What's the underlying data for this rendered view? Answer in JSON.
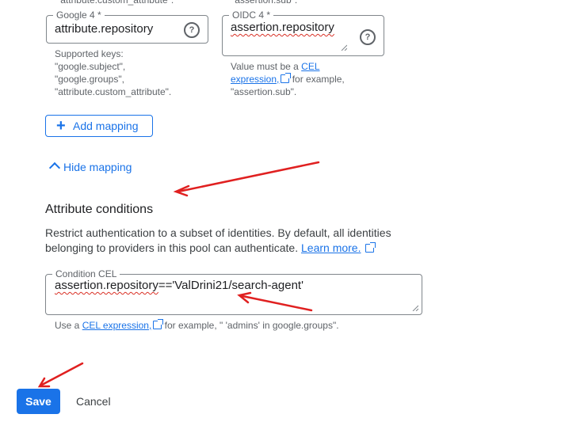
{
  "top_cut": {
    "left_hint_tail": "\"attribute.custom_attribute\".",
    "right_hint_tail": "\"assertion.sub\"."
  },
  "google_field": {
    "label": "Google 4 *",
    "value": "attribute.repository",
    "hint_lines": [
      "Supported keys:",
      "\"google.subject\",",
      "\"google.groups\",",
      "\"attribute.custom_attribute\"."
    ]
  },
  "oidc_field": {
    "label": "OIDC 4 *",
    "value": "assertion.repository",
    "hint_prefix": "Value must be a",
    "hint_link": "CEL expression,",
    "hint_suffix": "for example,",
    "hint_last": "\"assertion.sub\"."
  },
  "add_mapping_label": "Add mapping",
  "hide_mapping_label": "Hide mapping",
  "attribute_conditions": {
    "title": "Attribute conditions",
    "description": "Restrict authentication to a subset of identities. By default, all identities belonging to providers in this pool can authenticate.",
    "learn_more": "Learn more."
  },
  "condition_field": {
    "label": "Condition CEL",
    "value_underlined": "assertion.repository",
    "value_rest": "=='ValDrini21/search-agent'",
    "hint_prefix": "Use a",
    "hint_link": "CEL expression,",
    "hint_suffix": "for example, \" 'admins' in google.groups\"."
  },
  "save_label": "Save",
  "cancel_label": "Cancel",
  "colors": {
    "accent": "#1a73e8",
    "annotation_arrow": "#e02020"
  }
}
